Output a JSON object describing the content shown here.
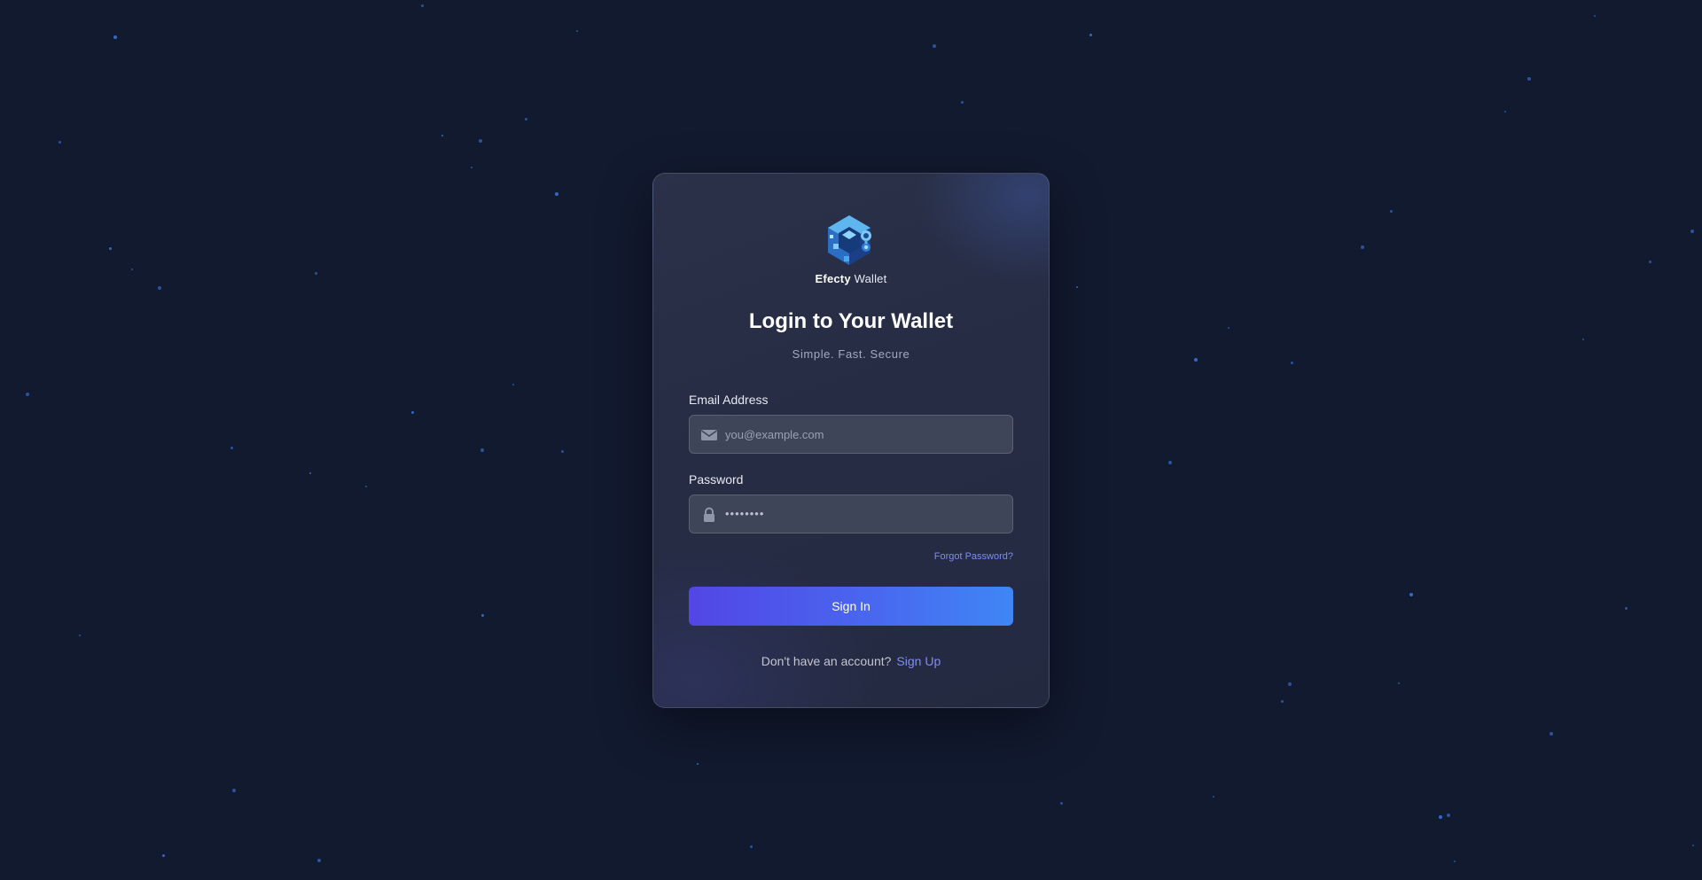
{
  "brand": {
    "name_bold": "Efecty",
    "name_rest": " Wallet",
    "logo_icon": "hexagon-wallet-logo"
  },
  "login": {
    "title": "Login to Your Wallet",
    "subtitle": "Simple. Fast. Secure",
    "email": {
      "label": "Email Address",
      "placeholder": "you@example.com",
      "value": "",
      "icon": "envelope-icon"
    },
    "password": {
      "label": "Password",
      "masked_value": "••••••••",
      "icon": "lock-icon"
    },
    "forgot_label": "Forgot Password?",
    "signin_label": "Sign In",
    "signup_prompt": "Don't have an account?",
    "signup_label": "Sign Up"
  },
  "colors": {
    "background": "#121a30",
    "accent": "#7f8cf4",
    "button_start": "#5246e6",
    "button_end": "#3f86f5",
    "star": "#3b6fd8"
  }
}
